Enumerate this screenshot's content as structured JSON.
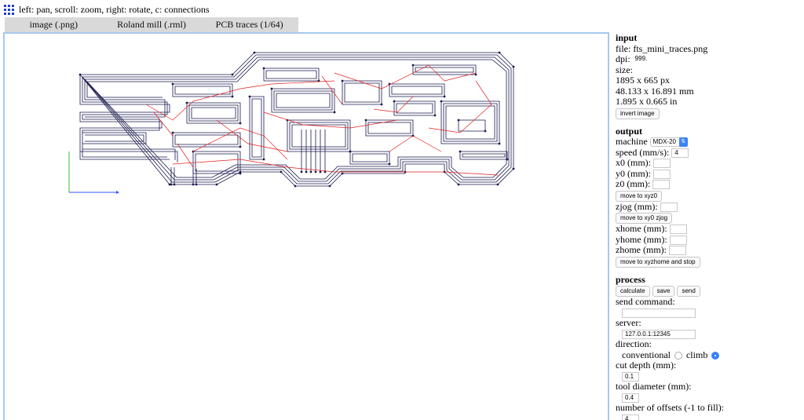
{
  "help_text": "left: pan, scroll: zoom, right: rotate, c: connections",
  "tabs": [
    "image (.png)",
    "Roland mill (.rml)",
    "PCB traces (1/64)"
  ],
  "input": {
    "title": "input",
    "file": "file: fts_mini_traces.png",
    "dpi_label": "dpi:",
    "dpi_value": "999.",
    "size_label": "size:",
    "size_px": "1895 x 665 px",
    "size_mm": "48.133 x 16.891 mm",
    "size_in": "1.895 x 0.665 in",
    "invert_button": "invert image"
  },
  "output": {
    "title": "output",
    "machine_label": "machine",
    "machine_value": "MDX-20",
    "speed_label": "speed (mm/s):",
    "speed_value": "4",
    "x0_label": "x0 (mm):",
    "y0_label": "y0 (mm):",
    "z0_label": "z0 (mm):",
    "move_xyz0_button": "move to xyz0",
    "zjog_label": "zjog (mm):",
    "move_xy0_zjog_button": "move to xy0 zjog",
    "xhome_label": "xhome (mm):",
    "yhome_label": "yhome (mm):",
    "zhome_label": "zhome (mm):",
    "move_home_stop_button": "move to xyzhome and stop"
  },
  "process": {
    "title": "process",
    "calculate_button": "calculate",
    "save_button": "save",
    "send_button": "send",
    "send_command_label": "send command:",
    "server_label": "server:",
    "server_value": "127.0.0.1:12345",
    "direction_label": "direction:",
    "conventional_label": "conventional",
    "climb_label": "climb",
    "cut_depth_label": "cut depth (mm):",
    "cut_depth_value": "0.1",
    "tool_diameter_label": "tool diameter (mm):",
    "tool_diameter_value": "0.4",
    "offsets_label": "number of offsets (-1 to fill):",
    "offsets_value": "4"
  },
  "colors": {
    "trace": "#1a1a4e",
    "connection": "#e02020",
    "accent": "#3b82f6",
    "x_axis": "#3355ff",
    "y_axis": "#33bb33"
  }
}
